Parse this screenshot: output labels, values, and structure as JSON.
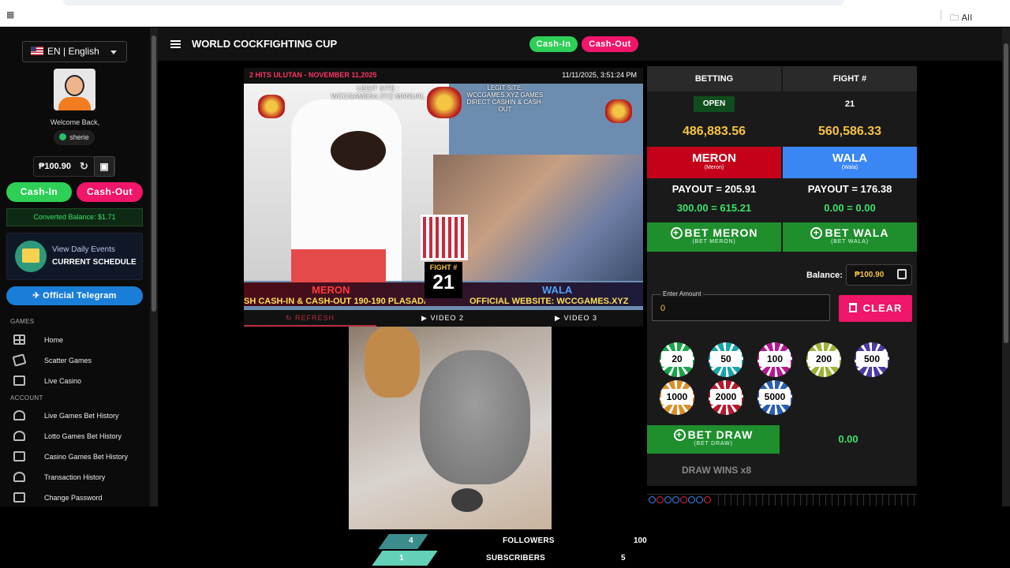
{
  "browser": {
    "bookmarks_label": "All Bookmarks"
  },
  "sidebar": {
    "language": "EN | English",
    "welcome": "Welcome Back,",
    "username": "sherie",
    "balance": "₱100.90",
    "cash_in": "Cash-In",
    "cash_out": "Cash-Out",
    "converted_balance": "Converted Balance: $1.71",
    "events_line1": "View Daily Events",
    "events_line2": "CURRENT SCHEDULE",
    "telegram": "Official Telegram",
    "section_games": "GAMES",
    "games": [
      {
        "label": "Home",
        "icon": "grid-icon"
      },
      {
        "label": "Scatter Games",
        "icon": "cards-icon"
      },
      {
        "label": "Live Casino",
        "icon": "play-icon"
      }
    ],
    "section_account": "ACCOUNT",
    "account": [
      {
        "label": "Live Games Bet History",
        "icon": "gamepad-icon"
      },
      {
        "label": "Lotto Games Bet History",
        "icon": "controller-icon"
      },
      {
        "label": "Casino Games Bet History",
        "icon": "casino-icon"
      },
      {
        "label": "Transaction History",
        "icon": "history-icon"
      },
      {
        "label": "Change Password",
        "icon": "lock-icon"
      }
    ]
  },
  "header": {
    "title": "WORLD COCKFIGHTING CUP",
    "cash_in": "Cash-In",
    "cash_out": "Cash-Out"
  },
  "video": {
    "event": "2 HITS ULUTAN - NOVEMBER 11,2025",
    "datetime": "11/11/2025, 3:51:24 PM",
    "legit_site": "LEGIT SITE : WCCGAMES4.XYZ MANUAL",
    "legit_site2": "LEGIT SITE: WCCGAMES.XYZ GAMES DIRECT CASHIN & CASH-OUT",
    "fight_label": "FIGHT #",
    "fight_number": "21",
    "meron": "MERON",
    "wala": "WALA",
    "ticker_left": "SH CASH-IN & CASH-OUT 190-190 PLASADA)",
    "ticker_right": "OFFICIAL WEBSITE: WCCGAMES.XYZ",
    "tabs": [
      "REFRESH",
      "VIDEO 2",
      "VIDEO 3"
    ]
  },
  "betting": {
    "col_betting": "BETTING",
    "col_fight": "FIGHT #",
    "status": "OPEN",
    "fight_number": "21",
    "meron_total": "486,883.56",
    "wala_total": "560,586.33",
    "meron_label": "MERON",
    "meron_sub": "(Meron)",
    "wala_label": "WALA",
    "wala_sub": "(Wala)",
    "meron_payout": "PAYOUT = 205.91",
    "wala_payout": "PAYOUT = 176.38",
    "meron_calc": "300.00 = 615.21",
    "wala_calc": "0.00 = 0.00",
    "bet_meron": "BET MERON",
    "bet_meron_sub": "(BET MERON)",
    "bet_wala": "BET WALA",
    "bet_wala_sub": "(BET WALA)",
    "balance_label": "Balance:",
    "balance": "₱100.90",
    "amount_label": "Enter Amount",
    "amount_value": "0",
    "clear": "CLEAR",
    "chips": [
      {
        "value": "20",
        "color": "#1aa54a"
      },
      {
        "value": "50",
        "color": "#17a5a8"
      },
      {
        "value": "100",
        "color": "#b5178f"
      },
      {
        "value": "200",
        "color": "#9db335"
      },
      {
        "value": "500",
        "color": "#4a3aa5"
      },
      {
        "value": "1000",
        "color": "#d9902a"
      },
      {
        "value": "2000",
        "color": "#b8182c"
      },
      {
        "value": "5000",
        "color": "#2a5fb3"
      }
    ],
    "bet_draw": "BET DRAW",
    "bet_draw_sub": "(BET DRAW)",
    "draw_value": "0.00",
    "draw_wins": "DRAW WINS x8"
  },
  "stats": {
    "followers_count": "4",
    "followers_label": "FOLLOWERS",
    "followers_right": "100",
    "subscribers_count": "1",
    "subscribers_label": "SUBSCRIBERS",
    "subscribers_right": "5"
  }
}
